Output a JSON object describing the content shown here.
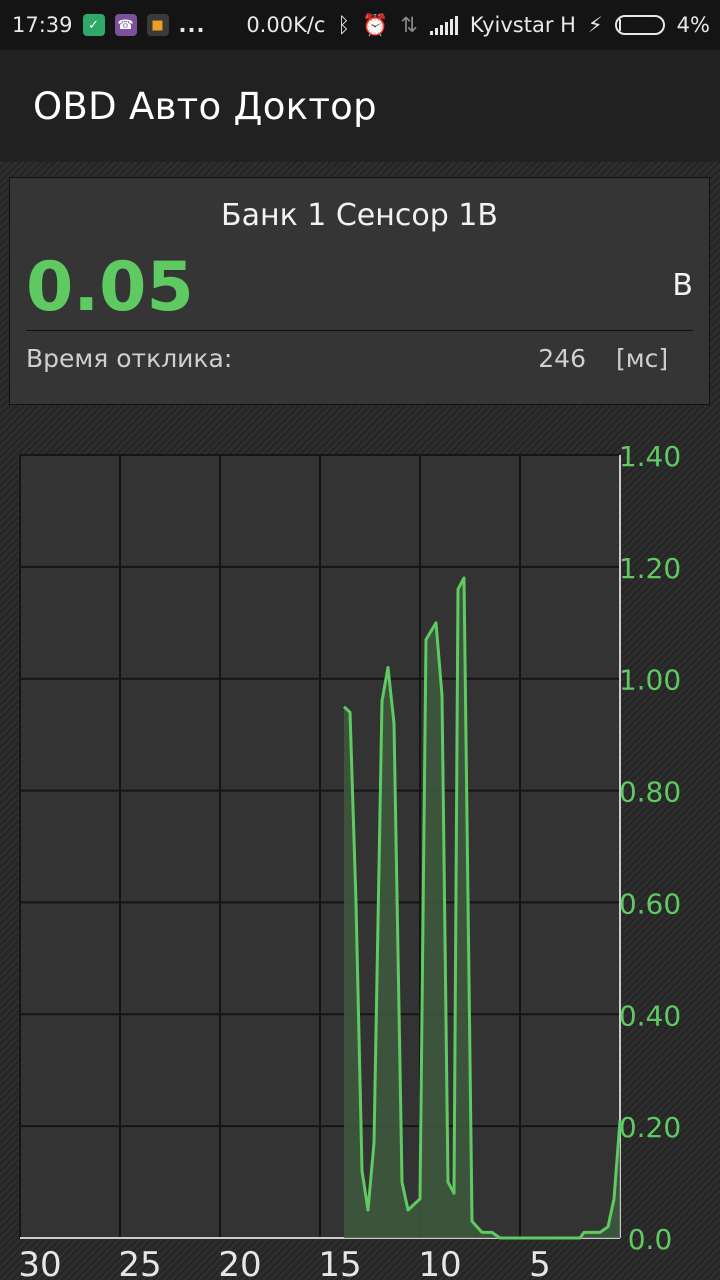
{
  "status_bar": {
    "time": "17:39",
    "more": "...",
    "net_speed": "0.00K/c",
    "carrier": "Kyivstar H",
    "battery": "4%",
    "battery_level": 0.04,
    "icons": [
      "shield-icon",
      "viber-icon",
      "app-icon",
      "bluetooth-icon",
      "alarm-icon",
      "data-arrows-icon",
      "signal-icon",
      "charging-icon",
      "battery-icon"
    ]
  },
  "appbar": {
    "title": "OBD Авто Доктор"
  },
  "sensor": {
    "name": "Банк 1 Сенсор 1В",
    "value": "0.05",
    "unit": "В",
    "response_label": "Время отклика:",
    "response_value": "246",
    "response_unit": "[мс]"
  },
  "colors": {
    "accent": "#5fca62",
    "fill": "#3f5a3e",
    "plot_bg": "#333333",
    "grid": "#151515"
  },
  "chart_data": {
    "type": "area",
    "title": "",
    "xlabel": "",
    "ylabel": "",
    "xlim": [
      30,
      0
    ],
    "ylim": [
      0,
      1.4
    ],
    "x_ticks": [
      "30",
      "25",
      "20",
      "15",
      "10",
      "5"
    ],
    "y_ticks": [
      "1.40",
      "1.20",
      "1.00",
      "0.80",
      "0.60",
      "0.40",
      "0.20",
      "0.0"
    ],
    "grid": true,
    "series": [
      {
        "x": [
          13.8,
          13.5,
          13.2,
          12.9,
          12.6,
          12.3,
          11.9,
          11.6,
          11.3,
          10.9,
          10.6,
          10.0,
          9.7,
          9.2,
          8.9,
          8.6,
          8.3,
          8.1,
          7.8,
          7.4,
          6.9,
          6.4,
          6.0,
          5.0,
          4.0,
          3.0,
          2.0,
          1.8,
          1.0,
          0.6,
          0.3,
          0.0
        ],
        "y": [
          0.95,
          0.94,
          0.6,
          0.12,
          0.05,
          0.17,
          0.96,
          1.02,
          0.92,
          0.1,
          0.05,
          0.07,
          1.07,
          1.1,
          0.97,
          0.1,
          0.08,
          1.16,
          1.18,
          0.03,
          0.01,
          0.01,
          0.0,
          0.0,
          0.0,
          0.0,
          0.0,
          0.01,
          0.01,
          0.02,
          0.07,
          0.21
        ]
      }
    ]
  }
}
